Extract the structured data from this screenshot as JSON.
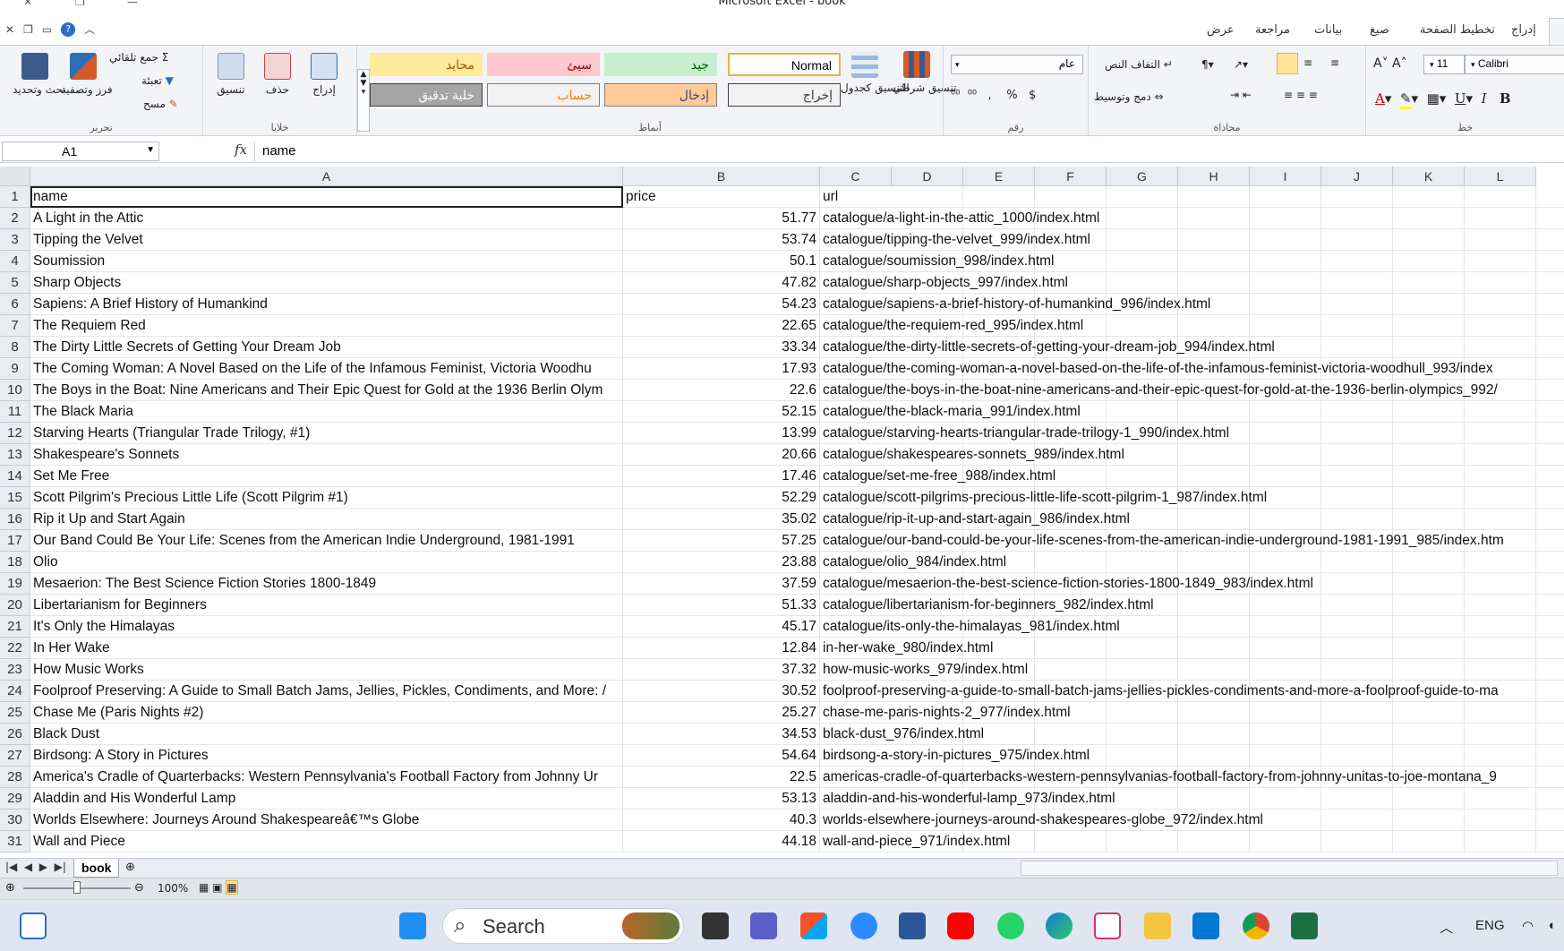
{
  "window": {
    "title": "Microsoft Excel - book"
  },
  "tabs": [
    "عرض",
    "مراجعة",
    "بيانات",
    "صيغ",
    "تخطيط الصفحة",
    "إدراج"
  ],
  "ribbon": {
    "font": {
      "name": "Calibri",
      "size": "11",
      "label": "خط"
    },
    "alignment": {
      "label": "محاذاة",
      "wrap": "التفاف النص",
      "merge": "دمج وتوسيط"
    },
    "number": {
      "label": "رقم",
      "format": "عام"
    },
    "styles": {
      "label": "أنماط",
      "conditional": "تنسيق شرطي",
      "table": "التنسيق كجدول",
      "boxes": [
        {
          "text": "Normal",
          "bg": "#ffffff",
          "color": "#000000",
          "border": "#e5b540"
        },
        {
          "text": "جيد",
          "bg": "#c6efce",
          "color": "#006100",
          "border": "#c6efce"
        },
        {
          "text": "سيئ",
          "bg": "#ffc7ce",
          "color": "#9c0006",
          "border": "#ffc7ce"
        },
        {
          "text": "محايد",
          "bg": "#ffeb9c",
          "color": "#9c5700",
          "border": "#ffeb9c"
        },
        {
          "text": "إخراج",
          "bg": "#f2f2f2",
          "color": "#3f3f3f",
          "border": "#3f3f3f"
        },
        {
          "text": "إدخال",
          "bg": "#ffcc99",
          "color": "#3f3f76",
          "border": "#7f7f7f"
        },
        {
          "text": "حساب",
          "bg": "#f2f2f2",
          "color": "#fa7d00",
          "border": "#7f7f7f"
        },
        {
          "text": "خلية تدقيق",
          "bg": "#a5a5a5",
          "color": "#ffffff",
          "border": "#3f3f3f"
        }
      ]
    },
    "cells": {
      "label": "خلايا",
      "insert": "إدراج",
      "delete": "حذف",
      "format": "تنسيق"
    },
    "editing": {
      "label": "تحرير",
      "autosum": "جمع تلقائي",
      "fill": "تعبئة",
      "clear": "مسح",
      "sort": "فرز وتصفية",
      "find": "بحث وتحديد"
    }
  },
  "formula_bar": {
    "name_box": "A1",
    "fx": "fx",
    "content": "name"
  },
  "columns": [
    "A",
    "B",
    "C",
    "D",
    "E",
    "F",
    "G",
    "H",
    "I",
    "J",
    "K",
    "L"
  ],
  "rows": [
    {
      "n": "1",
      "a": "name",
      "b": "price",
      "c": "url",
      "header": true
    },
    {
      "n": "2",
      "a": "A Light in the Attic",
      "b": "51.77",
      "c": "catalogue/a-light-in-the-attic_1000/index.html"
    },
    {
      "n": "3",
      "a": "Tipping the Velvet",
      "b": "53.74",
      "c": "catalogue/tipping-the-velvet_999/index.html"
    },
    {
      "n": "4",
      "a": "Soumission",
      "b": "50.1",
      "c": "catalogue/soumission_998/index.html"
    },
    {
      "n": "5",
      "a": "Sharp Objects",
      "b": "47.82",
      "c": "catalogue/sharp-objects_997/index.html"
    },
    {
      "n": "6",
      "a": "Sapiens: A Brief History of Humankind",
      "b": "54.23",
      "c": "catalogue/sapiens-a-brief-history-of-humankind_996/index.html"
    },
    {
      "n": "7",
      "a": "The Requiem Red",
      "b": "22.65",
      "c": "catalogue/the-requiem-red_995/index.html"
    },
    {
      "n": "8",
      "a": "The Dirty Little Secrets of Getting Your Dream Job",
      "b": "33.34",
      "c": "catalogue/the-dirty-little-secrets-of-getting-your-dream-job_994/index.html"
    },
    {
      "n": "9",
      "a": "The Coming Woman: A Novel Based on the Life of the Infamous Feminist, Victoria Woodhu",
      "b": "17.93",
      "c": "catalogue/the-coming-woman-a-novel-based-on-the-life-of-the-infamous-feminist-victoria-woodhull_993/index"
    },
    {
      "n": "10",
      "a": "The Boys in the Boat: Nine Americans and Their Epic Quest for Gold at the 1936 Berlin Olym",
      "b": "22.6",
      "c": "catalogue/the-boys-in-the-boat-nine-americans-and-their-epic-quest-for-gold-at-the-1936-berlin-olympics_992/"
    },
    {
      "n": "11",
      "a": "The Black Maria",
      "b": "52.15",
      "c": "catalogue/the-black-maria_991/index.html"
    },
    {
      "n": "12",
      "a": "Starving Hearts (Triangular Trade Trilogy, #1)",
      "b": "13.99",
      "c": "catalogue/starving-hearts-triangular-trade-trilogy-1_990/index.html"
    },
    {
      "n": "13",
      "a": "Shakespeare's Sonnets",
      "b": "20.66",
      "c": "catalogue/shakespeares-sonnets_989/index.html"
    },
    {
      "n": "14",
      "a": "Set Me Free",
      "b": "17.46",
      "c": "catalogue/set-me-free_988/index.html"
    },
    {
      "n": "15",
      "a": "Scott Pilgrim's Precious Little Life (Scott Pilgrim #1)",
      "b": "52.29",
      "c": "catalogue/scott-pilgrims-precious-little-life-scott-pilgrim-1_987/index.html"
    },
    {
      "n": "16",
      "a": "Rip it Up and Start Again",
      "b": "35.02",
      "c": "catalogue/rip-it-up-and-start-again_986/index.html"
    },
    {
      "n": "17",
      "a": "Our Band Could Be Your Life: Scenes from the American Indie Underground, 1981-1991",
      "b": "57.25",
      "c": "catalogue/our-band-could-be-your-life-scenes-from-the-american-indie-underground-1981-1991_985/index.htm"
    },
    {
      "n": "18",
      "a": "Olio",
      "b": "23.88",
      "c": "catalogue/olio_984/index.html"
    },
    {
      "n": "19",
      "a": "Mesaerion: The Best Science Fiction Stories 1800-1849",
      "b": "37.59",
      "c": "catalogue/mesaerion-the-best-science-fiction-stories-1800-1849_983/index.html"
    },
    {
      "n": "20",
      "a": "Libertarianism for Beginners",
      "b": "51.33",
      "c": "catalogue/libertarianism-for-beginners_982/index.html"
    },
    {
      "n": "21",
      "a": "It's Only the Himalayas",
      "b": "45.17",
      "c": "catalogue/its-only-the-himalayas_981/index.html"
    },
    {
      "n": "22",
      "a": "In Her Wake",
      "b": "12.84",
      "c": "in-her-wake_980/index.html"
    },
    {
      "n": "23",
      "a": "How Music Works",
      "b": "37.32",
      "c": "how-music-works_979/index.html"
    },
    {
      "n": "24",
      "a": "Foolproof Preserving: A Guide to Small Batch Jams, Jellies, Pickles, Condiments, and More: /",
      "b": "30.52",
      "c": "foolproof-preserving-a-guide-to-small-batch-jams-jellies-pickles-condiments-and-more-a-foolproof-guide-to-ma"
    },
    {
      "n": "25",
      "a": "Chase Me (Paris Nights #2)",
      "b": "25.27",
      "c": "chase-me-paris-nights-2_977/index.html"
    },
    {
      "n": "26",
      "a": "Black Dust",
      "b": "34.53",
      "c": "black-dust_976/index.html"
    },
    {
      "n": "27",
      "a": "Birdsong: A Story in Pictures",
      "b": "54.64",
      "c": "birdsong-a-story-in-pictures_975/index.html"
    },
    {
      "n": "28",
      "a": "America's Cradle of Quarterbacks: Western Pennsylvania's Football Factory from Johnny Ur",
      "b": "22.5",
      "c": "americas-cradle-of-quarterbacks-western-pennsylvanias-football-factory-from-johnny-unitas-to-joe-montana_9"
    },
    {
      "n": "29",
      "a": "Aladdin and His Wonderful Lamp",
      "b": "53.13",
      "c": "aladdin-and-his-wonderful-lamp_973/index.html"
    },
    {
      "n": "30",
      "a": "Worlds Elsewhere: Journeys Around Shakespeareâ€™s Globe",
      "b": "40.3",
      "c": "worlds-elsewhere-journeys-around-shakespeares-globe_972/index.html"
    },
    {
      "n": "31",
      "a": "Wall and Piece",
      "b": "44.18",
      "c": "wall-and-piece_971/index.html"
    }
  ],
  "sheet": {
    "name": "book"
  },
  "status": {
    "zoom": "100%"
  },
  "taskbar": {
    "search": "Search",
    "lang": "ENG"
  }
}
